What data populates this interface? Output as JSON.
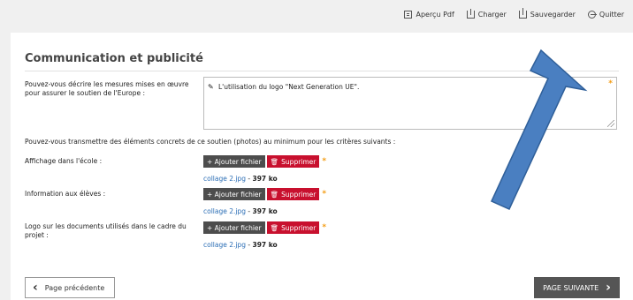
{
  "toolbar": {
    "pdf_label": "Aperçu Pdf",
    "load_label": "Charger",
    "save_label": "Sauvegarder",
    "quit_label": "Quitter"
  },
  "section": {
    "title": "Communication et publicité"
  },
  "question1": {
    "label": "Pouvez-vous décrire les mesures mises en œuvre pour assurer le soutien de l'Europe :",
    "value": "L'utilisation du logo \"Next Generation UE\"."
  },
  "intro": "Pouvez-vous transmettre des éléments concrets de ce soutien (photos) au minimum pour les critères suivants :",
  "criteria": [
    {
      "label": "Affichage dans l'école :",
      "add": "+ Ajouter fichier",
      "delete": "Supprimer",
      "file_name": "collage 2.jpg",
      "file_sep": " - ",
      "file_size": "397 ko"
    },
    {
      "label": "Information aux élèves :",
      "add": "+ Ajouter fichier",
      "delete": "Supprimer",
      "file_name": "collage 2.jpg",
      "file_sep": " - ",
      "file_size": "397 ko"
    },
    {
      "label": "Logo sur les documents utilisés dans le cadre du projet :",
      "add": "+ Ajouter fichier",
      "delete": "Supprimer",
      "file_name": "collage 2.jpg",
      "file_sep": " - ",
      "file_size": "397 ko"
    }
  ],
  "nav": {
    "prev_label": "Page précédente",
    "next_label": "PAGE SUIVANTE"
  },
  "colors": {
    "delete_red": "#c8102e",
    "add_gray": "#4d4d4d",
    "link_blue": "#2a6db5",
    "required_orange": "#f39c12",
    "arrow_blue": "#4a7fc1"
  }
}
